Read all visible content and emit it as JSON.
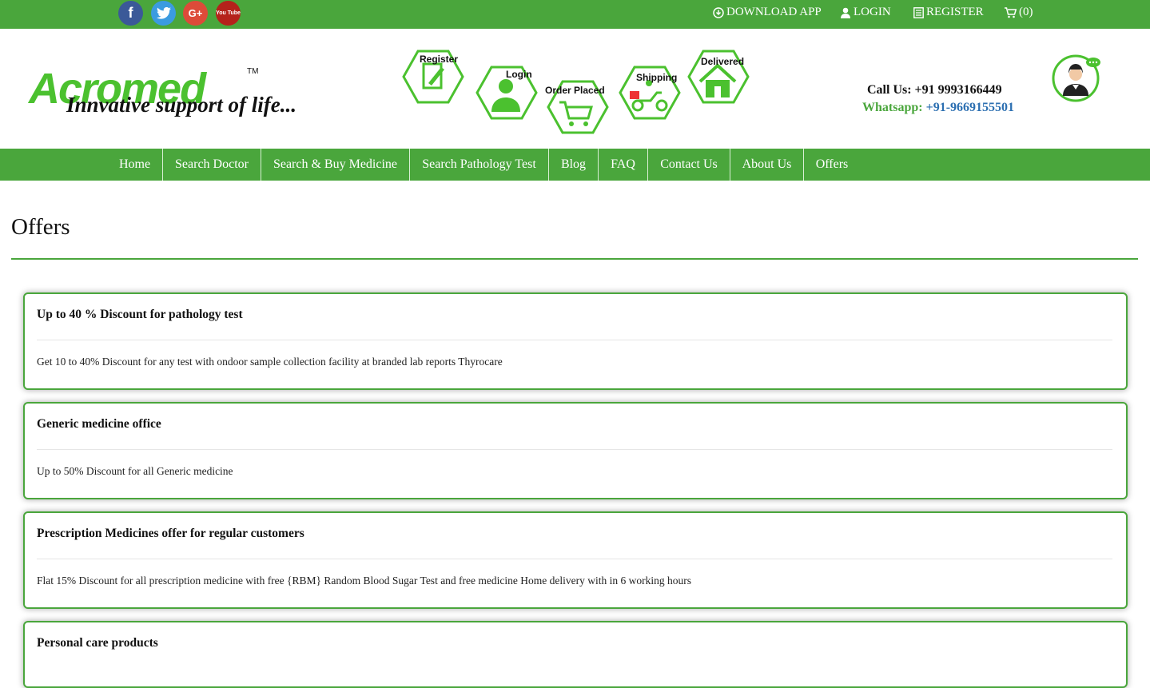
{
  "topbar": {
    "social": [
      {
        "name": "facebook-icon",
        "glyph": "f",
        "color": "#3b5998"
      },
      {
        "name": "twitter-icon",
        "glyph": "t",
        "color": "#3b9be0"
      },
      {
        "name": "google-plus-icon",
        "glyph": "G+",
        "color": "#dd4b39"
      },
      {
        "name": "youtube-icon",
        "glyph": "You Tube",
        "color": "#b5221b"
      }
    ],
    "download_app": "DOWNLOAD APP",
    "login": "LOGIN",
    "register": "REGISTER",
    "cart": "(0)"
  },
  "logo": {
    "wordmark": "Acromed",
    "tagline": "Innvative support of life...",
    "tm": "TM"
  },
  "steps": {
    "register": "Register",
    "login": "Login",
    "order_placed": "Order Placed",
    "shipping": "Shipping",
    "delivered": "Delivered"
  },
  "contact": {
    "call_us": "Call Us: +91 9993166449",
    "whatsapp_label": "Whatsapp:",
    "whatsapp_number": "+91-9669155501"
  },
  "nav": [
    "Home",
    "Search Doctor",
    "Search & Buy Medicine",
    "Search Pathology Test",
    "Blog",
    "FAQ",
    "Contact Us",
    "About Us",
    "Offers"
  ],
  "page": {
    "title": "Offers"
  },
  "offers": [
    {
      "title": "Up to 40 % Discount for pathology test",
      "body": "Get 10 to 40% Discount for any test with ondoor sample collection facility at branded lab reports Thyrocare"
    },
    {
      "title": "Generic medicine office",
      "body": "Up to 50% Discount for all Generic medicine"
    },
    {
      "title": "Prescription Medicines offer for regular customers",
      "body": "Flat 15% Discount for all prescription medicine with free {RBM} Random Blood Sugar Test and free medicine Home delivery with in 6 working hours"
    },
    {
      "title": "Personal care products",
      "body": ""
    }
  ],
  "colors": {
    "brand_green": "#4aa63c",
    "logo_green": "#4bc12f",
    "link_blue": "#2c6fb1"
  }
}
